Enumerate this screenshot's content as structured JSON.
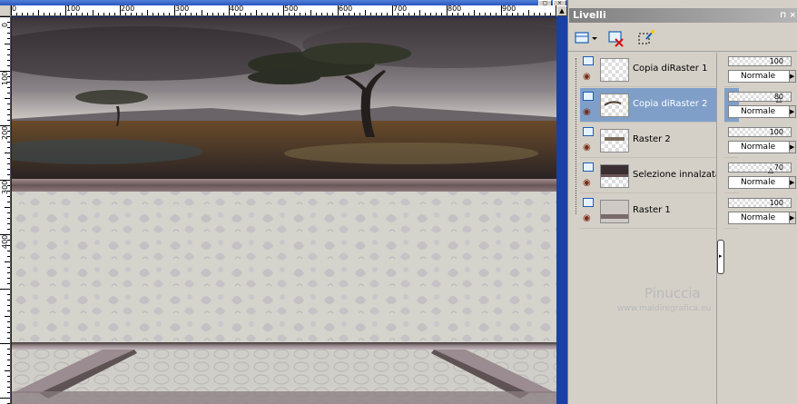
{
  "canvas": {
    "ruler_top_labels": [
      "0",
      "100",
      "200",
      "300",
      "400",
      "500",
      "600",
      "700",
      "800",
      "900"
    ],
    "ruler_left_labels": [
      "0",
      "100",
      "200",
      "300",
      "400"
    ]
  },
  "palette": {
    "title": "Livelli",
    "title_buttons": "⊓ ×",
    "toolbar": [
      {
        "name": "new-layer-icon"
      },
      {
        "name": "delete-layer-icon"
      },
      {
        "name": "mask-icon"
      }
    ],
    "layers": [
      {
        "name": "Copia diRaster 1",
        "opacity": "100",
        "blend": "Normale",
        "selected": false
      },
      {
        "name": "Copia diRaster 2",
        "opacity": "80",
        "blend": "Normale",
        "selected": true
      },
      {
        "name": "Raster 2",
        "opacity": "100",
        "blend": "Normale",
        "selected": false
      },
      {
        "name": "Selezione innalzata",
        "opacity": "70",
        "blend": "Normale",
        "selected": false
      },
      {
        "name": "Raster 1",
        "opacity": "100",
        "blend": "Normale",
        "selected": false
      }
    ]
  },
  "watermark": {
    "name": "Pinuccia",
    "url": "www.maidiregrafica.eu"
  },
  "colors": {
    "selection": "#7f9fc9",
    "window_blue": "#0a246a"
  }
}
